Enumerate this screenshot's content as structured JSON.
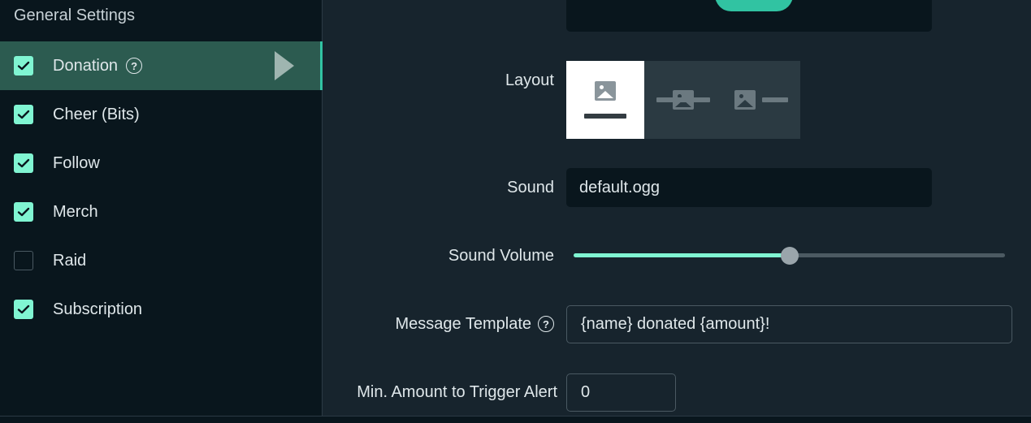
{
  "sidebar": {
    "header": "General Settings",
    "items": [
      {
        "label": "Donation",
        "checked": true,
        "active": true,
        "help": "?"
      },
      {
        "label": "Cheer (Bits)",
        "checked": true
      },
      {
        "label": "Follow",
        "checked": true
      },
      {
        "label": "Merch",
        "checked": true
      },
      {
        "label": "Raid",
        "checked": false
      },
      {
        "label": "Subscription",
        "checked": true
      }
    ]
  },
  "form": {
    "layout_label": "Layout",
    "layout_selected": "image-above-text",
    "sound_label": "Sound",
    "sound_value": "default.ogg",
    "volume_label": "Sound Volume",
    "volume_fraction": 0.5,
    "message_label": "Message Template",
    "message_help": "?",
    "message_value": "{name} donated {amount}!",
    "min_amount_label": "Min. Amount to Trigger Alert",
    "min_amount_value": "0"
  },
  "colors": {
    "accent": "#80f5d2",
    "accent_dark": "#31c3a2",
    "active_bg": "#2c5b50"
  }
}
